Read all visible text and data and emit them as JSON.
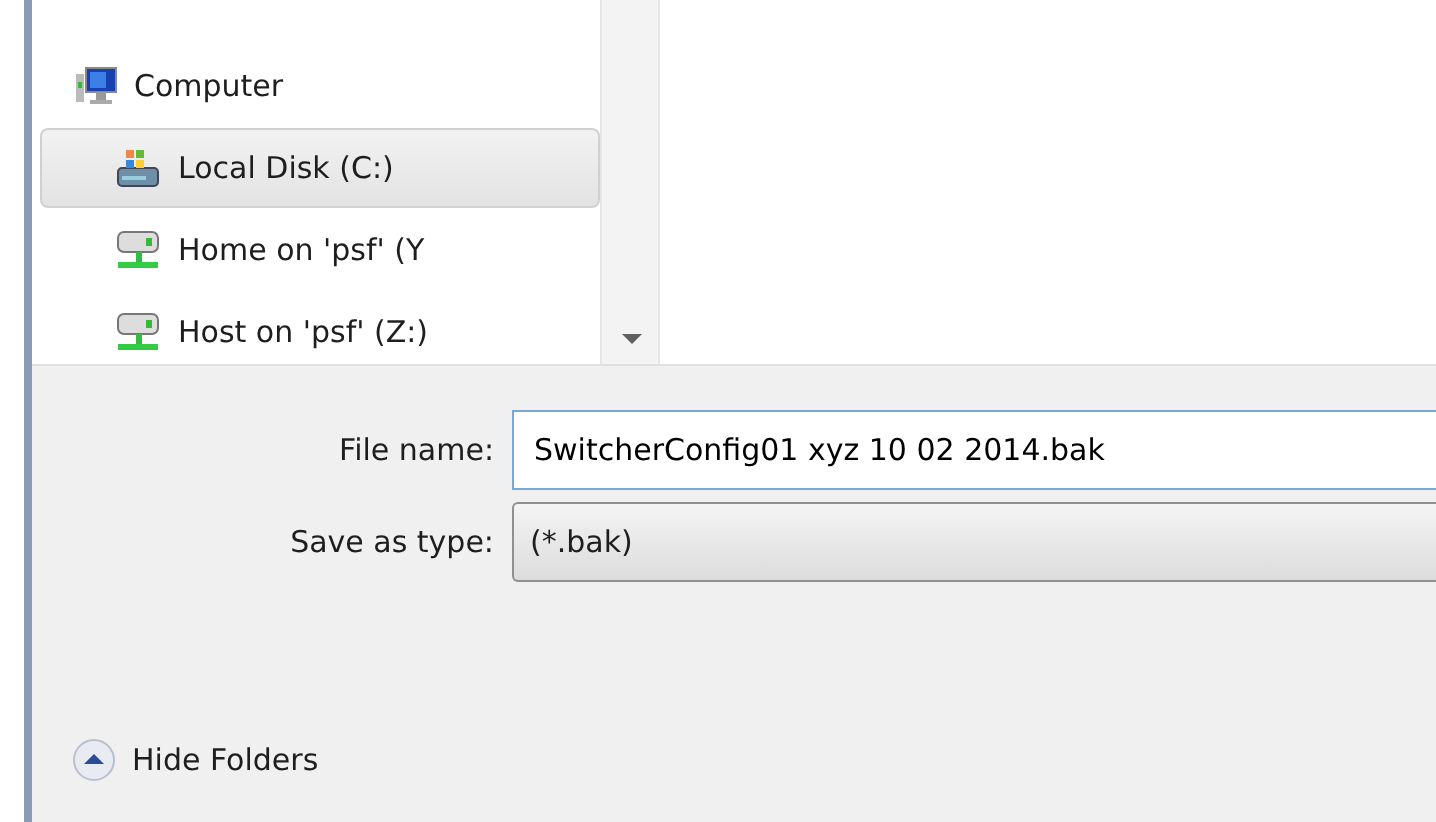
{
  "navigation": {
    "items": [
      {
        "label": "Computer",
        "kind": "computer",
        "selected": false,
        "children": [
          {
            "label": "Local Disk (C:)",
            "kind": "disk",
            "selected": true
          },
          {
            "label": "Home on 'psf' (Y",
            "kind": "network",
            "selected": false
          },
          {
            "label": "Host on 'psf' (Z:)",
            "kind": "network",
            "selected": false
          }
        ]
      }
    ]
  },
  "form": {
    "fields": [
      {
        "label": "File name:",
        "kind": "text",
        "value": "SwitcherConfig01 xyz 10 02 2014.bak"
      },
      {
        "label": "Save as type:",
        "kind": "combo",
        "value": "(*.bak)"
      }
    ]
  },
  "hide_folders": {
    "label": "Hide Folders"
  }
}
